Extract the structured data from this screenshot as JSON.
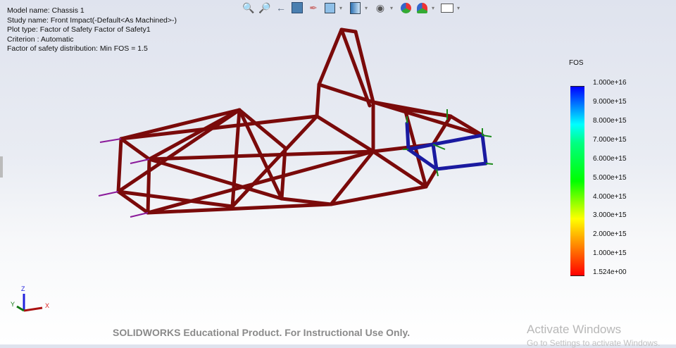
{
  "info": {
    "model": "Model name: Chassis 1",
    "study": "Study name: Front Impact(-Default<As Machined>-)",
    "plot_type": "Plot type: Factor of Safety Factor of Safety1",
    "criterion": "Criterion : Automatic",
    "distribution": "Factor of safety distribution: Min FOS = 1.5"
  },
  "toolbar": [
    "zoom-to-fit-icon",
    "zoom-area-icon",
    "previous-view-icon",
    "section-view-icon",
    "view-dynamic-annotation-icon",
    "view-orientation-icon",
    "display-style-icon",
    "hide-show-items-icon",
    "edit-appearance-icon",
    "apply-scene-icon",
    "view-settings-icon"
  ],
  "legend": {
    "title": "FOS",
    "labels": [
      "1.000e+16",
      "9.000e+15",
      "8.000e+15",
      "7.000e+15",
      "6.000e+15",
      "5.000e+15",
      "4.000e+15",
      "3.000e+15",
      "2.000e+15",
      "1.000e+15",
      "1.524e+00"
    ],
    "colors": {
      "max": "#0000ff",
      "min": "#ff0000",
      "member": "#7a0a0a"
    }
  },
  "triad": {
    "x": "X",
    "y": "Y",
    "z": "Z"
  },
  "watermark": "SOLIDWORKS Educational Product. For Instructional Use Only.",
  "activation": {
    "title": "Activate Windows",
    "subtitle": "Go to Settings to activate Windows."
  }
}
